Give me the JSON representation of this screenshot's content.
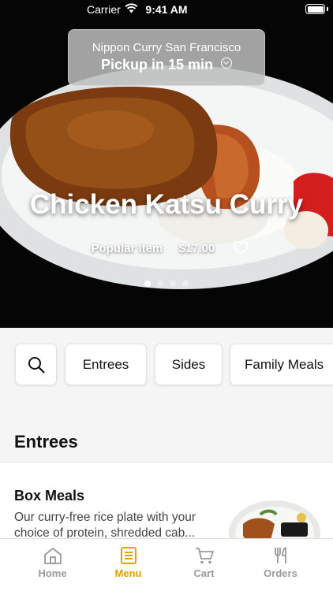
{
  "status_bar": {
    "carrier": "Carrier",
    "time": "9:41 AM"
  },
  "store": {
    "name": "Nippon Curry San Francisco",
    "pickup": "Pickup in 15 min"
  },
  "hero": {
    "title": "Chicken Katsu Curry",
    "tag": "Popular Item",
    "price": "$17.00",
    "slides_total": 4,
    "slide_active": 1
  },
  "categories": [
    "Entrees",
    "Sides",
    "Family Meals"
  ],
  "section": {
    "title": "Entrees"
  },
  "items": [
    {
      "name": "Box Meals",
      "description": "Our curry-free rice plate with your choice of protein, shredded cab..."
    }
  ],
  "tabs": [
    {
      "label": "Home",
      "icon": "home-icon",
      "active": false
    },
    {
      "label": "Menu",
      "icon": "menu-book-icon",
      "active": true
    },
    {
      "label": "Cart",
      "icon": "cart-icon",
      "active": false
    },
    {
      "label": "Orders",
      "icon": "fork-knife-icon",
      "active": false
    }
  ],
  "colors": {
    "accent": "#e0a100",
    "inactive": "#999999"
  }
}
